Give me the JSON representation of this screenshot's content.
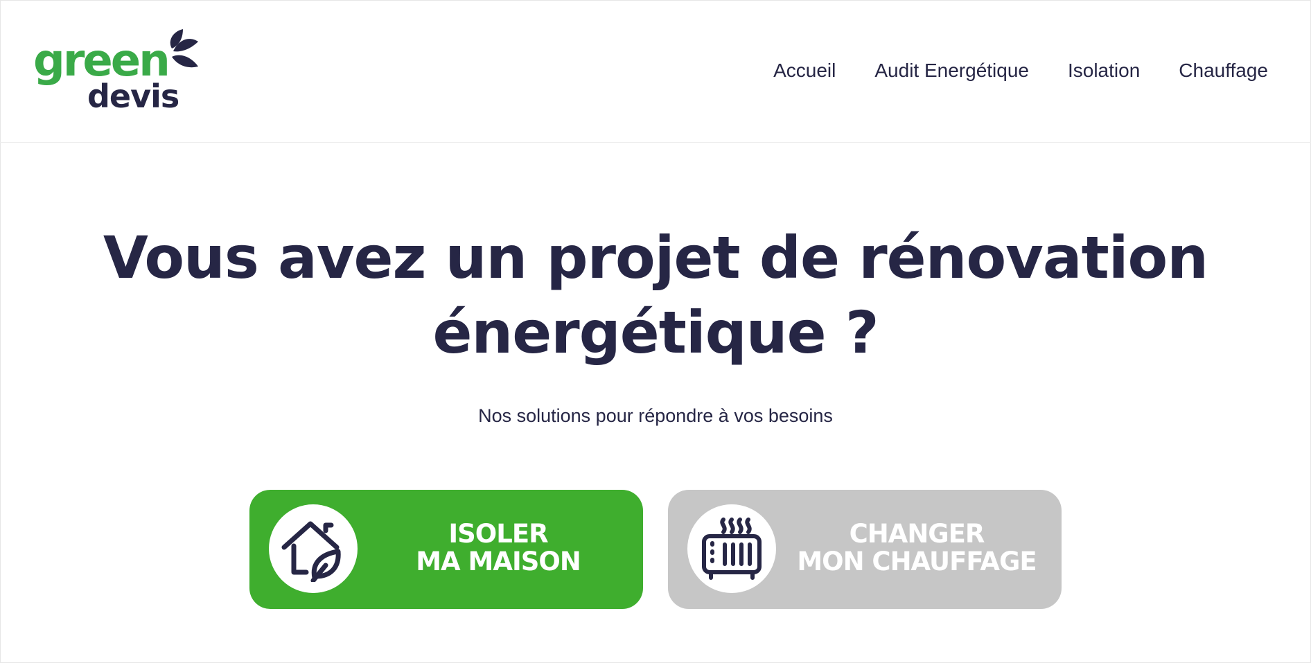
{
  "logo": {
    "line1": "green",
    "line2": "devis",
    "colors": {
      "green": "#3aaa48",
      "dark": "#262645"
    }
  },
  "nav": {
    "items": [
      {
        "label": "Accueil"
      },
      {
        "label": "Audit Energétique"
      },
      {
        "label": "Isolation"
      },
      {
        "label": "Chauffage"
      }
    ]
  },
  "hero": {
    "title_line1": "Vous avez un projet de rénovation",
    "title_line2": "énergétique ?",
    "subtitle": "Nos solutions pour répondre à vos besoins"
  },
  "actions": {
    "isoler": {
      "line1": "ISOLER",
      "line2": "MA MAISON",
      "icon": "house-leaf-icon",
      "color": "#3fae2e"
    },
    "chauffage": {
      "line1": "CHANGER",
      "line2": "MON CHAUFFAGE",
      "icon": "radiator-icon",
      "color": "#c6c6c6"
    }
  }
}
